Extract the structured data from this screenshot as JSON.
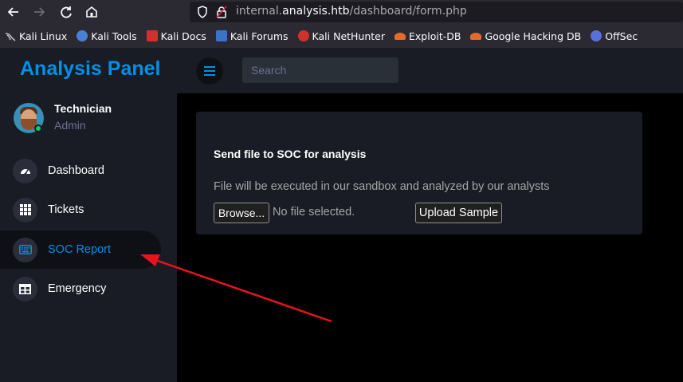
{
  "browser": {
    "url_prefix": "internal.",
    "url_domain": "analysis.htb",
    "url_path": "/dashboard/form.php",
    "bookmarks": [
      {
        "label": "Kali Linux",
        "icon": "kali-dragon-icon",
        "color": "#c8c8c8"
      },
      {
        "label": "Kali Tools",
        "icon": "kali-tools-icon",
        "color": "#4a7fd4"
      },
      {
        "label": "Kali Docs",
        "icon": "kali-docs-icon",
        "color": "#d42f2f"
      },
      {
        "label": "Kali Forums",
        "icon": "kali-forums-icon",
        "color": "#3b73c9"
      },
      {
        "label": "Kali NetHunter",
        "icon": "nethunter-icon",
        "color": "#d42f2f"
      },
      {
        "label": "Exploit-DB",
        "icon": "exploit-db-icon",
        "color": "#e56b2c"
      },
      {
        "label": "Google Hacking DB",
        "icon": "ghdb-icon",
        "color": "#e56b2c"
      },
      {
        "label": "OffSec",
        "icon": "offsec-icon",
        "color": "#5a6fd8"
      }
    ]
  },
  "sidebar": {
    "brand": "Analysis Panel",
    "user": {
      "name": "Technician",
      "role": "Admin"
    },
    "items": [
      {
        "label": "Dashboard",
        "icon": "speedometer-icon",
        "active": false
      },
      {
        "label": "Tickets",
        "icon": "grid-icon",
        "active": false
      },
      {
        "label": "SOC Report",
        "icon": "keyboard-icon",
        "active": true
      },
      {
        "label": "Emergency",
        "icon": "table-icon",
        "active": false
      }
    ]
  },
  "navbar": {
    "search_placeholder": "Search"
  },
  "form": {
    "title": "Send file to SOC for analysis",
    "description": "File will be executed in our sandbox and analyzed by our analysts",
    "browse_label": "Browse...",
    "no_file_label": "No file selected.",
    "upload_label": "Upload Sample"
  },
  "colors": {
    "accent": "#0090e7",
    "annotation_arrow": "#e8141c",
    "online_status": "#00d25b"
  }
}
